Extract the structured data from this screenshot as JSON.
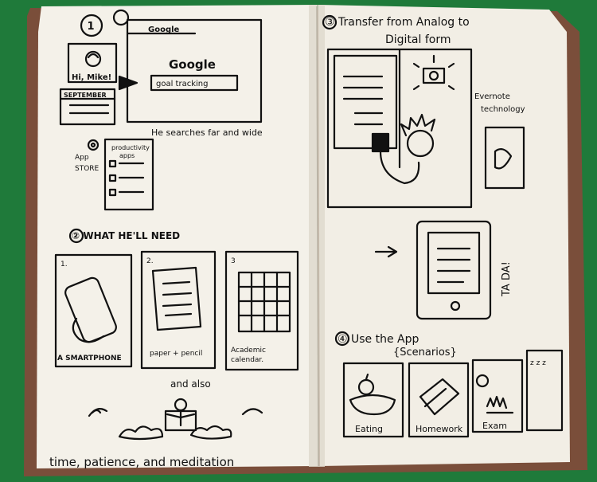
{
  "left_page": {
    "step1_number": "1",
    "browser_tab": "Google",
    "google_logo": "Google",
    "search_query": "goal tracking",
    "avatar_greeting": "Hi, Mike!",
    "calendar_label": "SEPTEMBER",
    "search_caption": "He searches far and wide",
    "app_store_label_line1": "App",
    "app_store_label_line2": "STORE",
    "productivity_label_line1": "productivity",
    "productivity_label_line2": "apps",
    "step2_heading": "② WHAT HE'LL NEED",
    "panel1_number": "1.",
    "panel1_caption": "A SMARTPHONE",
    "panel2_number": "2.",
    "panel2_caption": "paper + pencil",
    "panel3_number": "3",
    "panel3_caption_line1": "Academic",
    "panel3_caption_line2": "calendar.",
    "and_also": "and also",
    "bottom_line": "time, patience, and meditation"
  },
  "right_page": {
    "step3_heading_line1": "③ Transfer from Analog to",
    "step3_heading_line2": "Digital form",
    "evernote_line1": "Evernote",
    "evernote_line2": "technology",
    "tada": "TA DA!",
    "step4_heading": "④ Use the App",
    "scenarios": "{Scenarios}",
    "scenario_labels": [
      "Eating",
      "Homework",
      "Exam"
    ],
    "sleep_marks": "z z z"
  },
  "colors": {
    "table": "#1f7a3a",
    "paper": "#f3efe6",
    "ink": "#111111",
    "cover": "#7a4e3a"
  }
}
